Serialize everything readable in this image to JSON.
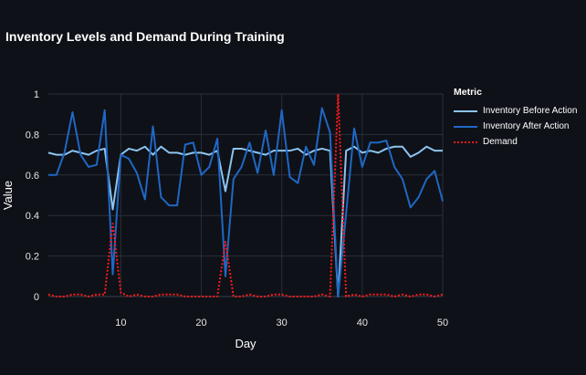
{
  "chart_data": {
    "type": "line",
    "title": "Inventory Levels and Demand During Training",
    "xlabel": "Day",
    "ylabel": "Value",
    "xlim": [
      1,
      50
    ],
    "ylim": [
      0,
      1
    ],
    "x_ticks": [
      10,
      20,
      30,
      40,
      50
    ],
    "y_ticks": [
      0,
      0.2,
      0.4,
      0.6,
      0.8,
      1
    ],
    "y_tick_labels": [
      "0",
      "0.2",
      "0.4",
      "0.6",
      "0.8",
      "1"
    ],
    "grid": true,
    "legend_title": "Metric",
    "legend_placement": "right",
    "x": [
      1,
      2,
      3,
      4,
      5,
      6,
      7,
      8,
      9,
      10,
      11,
      12,
      13,
      14,
      15,
      16,
      17,
      18,
      19,
      20,
      21,
      22,
      23,
      24,
      25,
      26,
      27,
      28,
      29,
      30,
      31,
      32,
      33,
      34,
      35,
      36,
      37,
      38,
      39,
      40,
      41,
      42,
      43,
      44,
      45,
      46,
      47,
      48,
      49,
      50
    ],
    "series": [
      {
        "name": "Inventory Before Action",
        "color": "#8cc4f0",
        "style": "solid",
        "values": [
          0.71,
          0.7,
          0.7,
          0.72,
          0.71,
          0.7,
          0.72,
          0.73,
          0.43,
          0.7,
          0.73,
          0.72,
          0.74,
          0.7,
          0.74,
          0.71,
          0.71,
          0.7,
          0.71,
          0.71,
          0.7,
          0.72,
          0.52,
          0.73,
          0.73,
          0.72,
          0.71,
          0.7,
          0.72,
          0.72,
          0.72,
          0.73,
          0.7,
          0.72,
          0.73,
          0.72,
          0.0,
          0.72,
          0.74,
          0.71,
          0.72,
          0.71,
          0.73,
          0.74,
          0.74,
          0.69,
          0.71,
          0.74,
          0.72,
          0.72
        ]
      },
      {
        "name": "Inventory After Action",
        "color": "#1f67c4",
        "style": "solid",
        "values": [
          0.6,
          0.6,
          0.71,
          0.91,
          0.7,
          0.64,
          0.65,
          0.92,
          0.11,
          0.7,
          0.68,
          0.61,
          0.48,
          0.84,
          0.49,
          0.45,
          0.45,
          0.75,
          0.76,
          0.6,
          0.64,
          0.78,
          0.1,
          0.58,
          0.64,
          0.76,
          0.61,
          0.82,
          0.6,
          0.92,
          0.59,
          0.56,
          0.74,
          0.65,
          0.93,
          0.81,
          0.0,
          0.41,
          0.83,
          0.64,
          0.76,
          0.76,
          0.77,
          0.64,
          0.58,
          0.44,
          0.49,
          0.58,
          0.62,
          0.47
        ]
      },
      {
        "name": "Demand",
        "color": "#ff1a1a",
        "style": "dotted",
        "values": [
          0.01,
          0.0,
          0.0,
          0.01,
          0.01,
          0.0,
          0.01,
          0.01,
          0.36,
          0.02,
          0.0,
          0.01,
          0.0,
          0.0,
          0.01,
          0.01,
          0.01,
          0.0,
          0.0,
          0.0,
          0.0,
          0.0,
          0.27,
          0.0,
          0.0,
          0.01,
          0.0,
          0.0,
          0.01,
          0.01,
          0.0,
          0.0,
          0.0,
          0.0,
          0.01,
          0.0,
          1.0,
          0.0,
          0.01,
          0.0,
          0.01,
          0.01,
          0.01,
          0.0,
          0.01,
          0.0,
          0.01,
          0.01,
          0.0,
          0.01
        ]
      }
    ]
  }
}
